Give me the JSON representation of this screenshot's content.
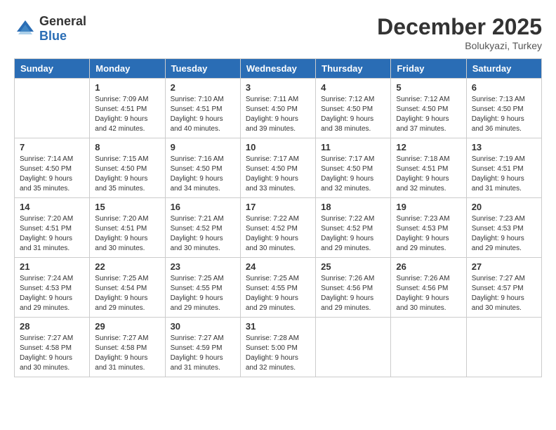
{
  "header": {
    "logo_general": "General",
    "logo_blue": "Blue",
    "month_year": "December 2025",
    "location": "Bolukyazi, Turkey"
  },
  "columns": [
    "Sunday",
    "Monday",
    "Tuesday",
    "Wednesday",
    "Thursday",
    "Friday",
    "Saturday"
  ],
  "weeks": [
    [
      {
        "day": "",
        "sunrise": "",
        "sunset": "",
        "daylight": ""
      },
      {
        "day": "1",
        "sunrise": "Sunrise: 7:09 AM",
        "sunset": "Sunset: 4:51 PM",
        "daylight": "Daylight: 9 hours and 42 minutes."
      },
      {
        "day": "2",
        "sunrise": "Sunrise: 7:10 AM",
        "sunset": "Sunset: 4:51 PM",
        "daylight": "Daylight: 9 hours and 40 minutes."
      },
      {
        "day": "3",
        "sunrise": "Sunrise: 7:11 AM",
        "sunset": "Sunset: 4:50 PM",
        "daylight": "Daylight: 9 hours and 39 minutes."
      },
      {
        "day": "4",
        "sunrise": "Sunrise: 7:12 AM",
        "sunset": "Sunset: 4:50 PM",
        "daylight": "Daylight: 9 hours and 38 minutes."
      },
      {
        "day": "5",
        "sunrise": "Sunrise: 7:12 AM",
        "sunset": "Sunset: 4:50 PM",
        "daylight": "Daylight: 9 hours and 37 minutes."
      },
      {
        "day": "6",
        "sunrise": "Sunrise: 7:13 AM",
        "sunset": "Sunset: 4:50 PM",
        "daylight": "Daylight: 9 hours and 36 minutes."
      }
    ],
    [
      {
        "day": "7",
        "sunrise": "Sunrise: 7:14 AM",
        "sunset": "Sunset: 4:50 PM",
        "daylight": "Daylight: 9 hours and 35 minutes."
      },
      {
        "day": "8",
        "sunrise": "Sunrise: 7:15 AM",
        "sunset": "Sunset: 4:50 PM",
        "daylight": "Daylight: 9 hours and 35 minutes."
      },
      {
        "day": "9",
        "sunrise": "Sunrise: 7:16 AM",
        "sunset": "Sunset: 4:50 PM",
        "daylight": "Daylight: 9 hours and 34 minutes."
      },
      {
        "day": "10",
        "sunrise": "Sunrise: 7:17 AM",
        "sunset": "Sunset: 4:50 PM",
        "daylight": "Daylight: 9 hours and 33 minutes."
      },
      {
        "day": "11",
        "sunrise": "Sunrise: 7:17 AM",
        "sunset": "Sunset: 4:50 PM",
        "daylight": "Daylight: 9 hours and 32 minutes."
      },
      {
        "day": "12",
        "sunrise": "Sunrise: 7:18 AM",
        "sunset": "Sunset: 4:51 PM",
        "daylight": "Daylight: 9 hours and 32 minutes."
      },
      {
        "day": "13",
        "sunrise": "Sunrise: 7:19 AM",
        "sunset": "Sunset: 4:51 PM",
        "daylight": "Daylight: 9 hours and 31 minutes."
      }
    ],
    [
      {
        "day": "14",
        "sunrise": "Sunrise: 7:20 AM",
        "sunset": "Sunset: 4:51 PM",
        "daylight": "Daylight: 9 hours and 31 minutes."
      },
      {
        "day": "15",
        "sunrise": "Sunrise: 7:20 AM",
        "sunset": "Sunset: 4:51 PM",
        "daylight": "Daylight: 9 hours and 30 minutes."
      },
      {
        "day": "16",
        "sunrise": "Sunrise: 7:21 AM",
        "sunset": "Sunset: 4:52 PM",
        "daylight": "Daylight: 9 hours and 30 minutes."
      },
      {
        "day": "17",
        "sunrise": "Sunrise: 7:22 AM",
        "sunset": "Sunset: 4:52 PM",
        "daylight": "Daylight: 9 hours and 30 minutes."
      },
      {
        "day": "18",
        "sunrise": "Sunrise: 7:22 AM",
        "sunset": "Sunset: 4:52 PM",
        "daylight": "Daylight: 9 hours and 29 minutes."
      },
      {
        "day": "19",
        "sunrise": "Sunrise: 7:23 AM",
        "sunset": "Sunset: 4:53 PM",
        "daylight": "Daylight: 9 hours and 29 minutes."
      },
      {
        "day": "20",
        "sunrise": "Sunrise: 7:23 AM",
        "sunset": "Sunset: 4:53 PM",
        "daylight": "Daylight: 9 hours and 29 minutes."
      }
    ],
    [
      {
        "day": "21",
        "sunrise": "Sunrise: 7:24 AM",
        "sunset": "Sunset: 4:53 PM",
        "daylight": "Daylight: 9 hours and 29 minutes."
      },
      {
        "day": "22",
        "sunrise": "Sunrise: 7:25 AM",
        "sunset": "Sunset: 4:54 PM",
        "daylight": "Daylight: 9 hours and 29 minutes."
      },
      {
        "day": "23",
        "sunrise": "Sunrise: 7:25 AM",
        "sunset": "Sunset: 4:55 PM",
        "daylight": "Daylight: 9 hours and 29 minutes."
      },
      {
        "day": "24",
        "sunrise": "Sunrise: 7:25 AM",
        "sunset": "Sunset: 4:55 PM",
        "daylight": "Daylight: 9 hours and 29 minutes."
      },
      {
        "day": "25",
        "sunrise": "Sunrise: 7:26 AM",
        "sunset": "Sunset: 4:56 PM",
        "daylight": "Daylight: 9 hours and 29 minutes."
      },
      {
        "day": "26",
        "sunrise": "Sunrise: 7:26 AM",
        "sunset": "Sunset: 4:56 PM",
        "daylight": "Daylight: 9 hours and 30 minutes."
      },
      {
        "day": "27",
        "sunrise": "Sunrise: 7:27 AM",
        "sunset": "Sunset: 4:57 PM",
        "daylight": "Daylight: 9 hours and 30 minutes."
      }
    ],
    [
      {
        "day": "28",
        "sunrise": "Sunrise: 7:27 AM",
        "sunset": "Sunset: 4:58 PM",
        "daylight": "Daylight: 9 hours and 30 minutes."
      },
      {
        "day": "29",
        "sunrise": "Sunrise: 7:27 AM",
        "sunset": "Sunset: 4:58 PM",
        "daylight": "Daylight: 9 hours and 31 minutes."
      },
      {
        "day": "30",
        "sunrise": "Sunrise: 7:27 AM",
        "sunset": "Sunset: 4:59 PM",
        "daylight": "Daylight: 9 hours and 31 minutes."
      },
      {
        "day": "31",
        "sunrise": "Sunrise: 7:28 AM",
        "sunset": "Sunset: 5:00 PM",
        "daylight": "Daylight: 9 hours and 32 minutes."
      },
      {
        "day": "",
        "sunrise": "",
        "sunset": "",
        "daylight": ""
      },
      {
        "day": "",
        "sunrise": "",
        "sunset": "",
        "daylight": ""
      },
      {
        "day": "",
        "sunrise": "",
        "sunset": "",
        "daylight": ""
      }
    ]
  ]
}
